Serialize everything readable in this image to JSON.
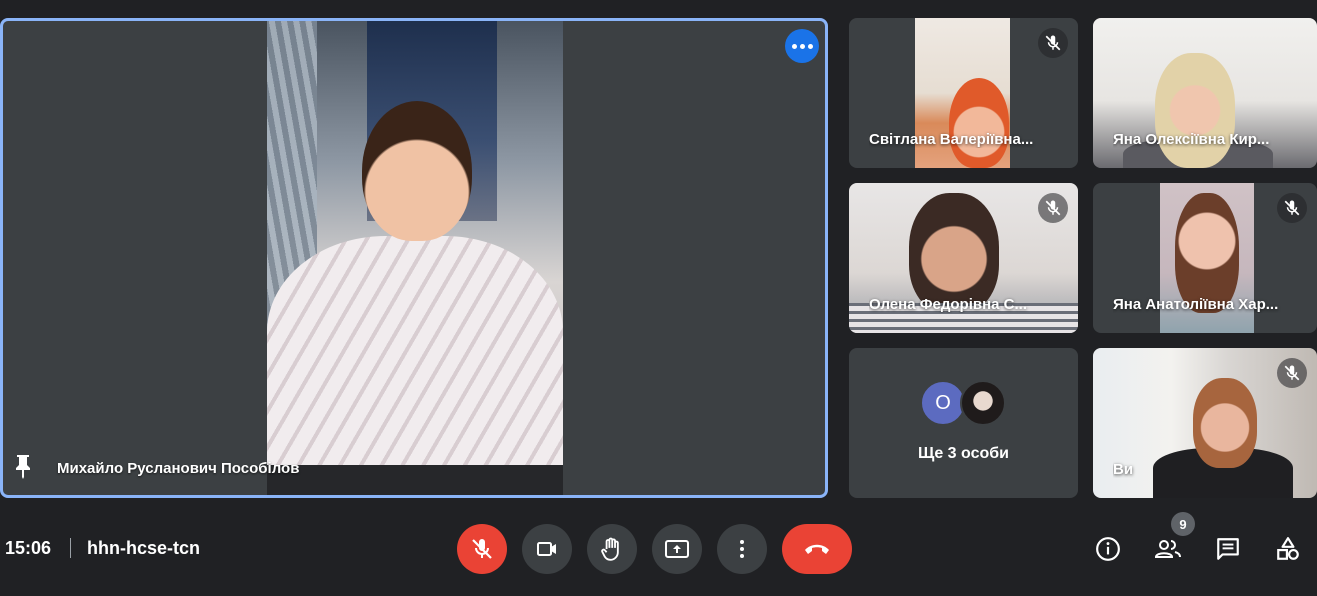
{
  "main": {
    "presenter_name": "Михайло Русланович Пособілов",
    "more_options_icon": "more-horiz-icon",
    "pin_icon": "pin-icon"
  },
  "tiles": [
    {
      "name": "Світлана Валеріївна...",
      "muted": true
    },
    {
      "name": "Яна Олексіївна Кир...",
      "muted": true
    },
    {
      "name": "Олена Федорівна С...",
      "muted": true
    },
    {
      "name": "Яна Анатоліївна Хар...",
      "muted": true
    },
    {
      "name": "Ви",
      "muted": true
    }
  ],
  "others": {
    "avatar_letter": "О",
    "label": "Ще 3 особи"
  },
  "bottom_bar": {
    "time": "15:06",
    "meeting_code": "hhn-hcse-tcn",
    "participants_count": "9"
  },
  "colors": {
    "background": "#202124",
    "tile": "#3c4043",
    "active_border": "#8ab4f8",
    "red": "#ea4335",
    "blue": "#1a73e8"
  }
}
